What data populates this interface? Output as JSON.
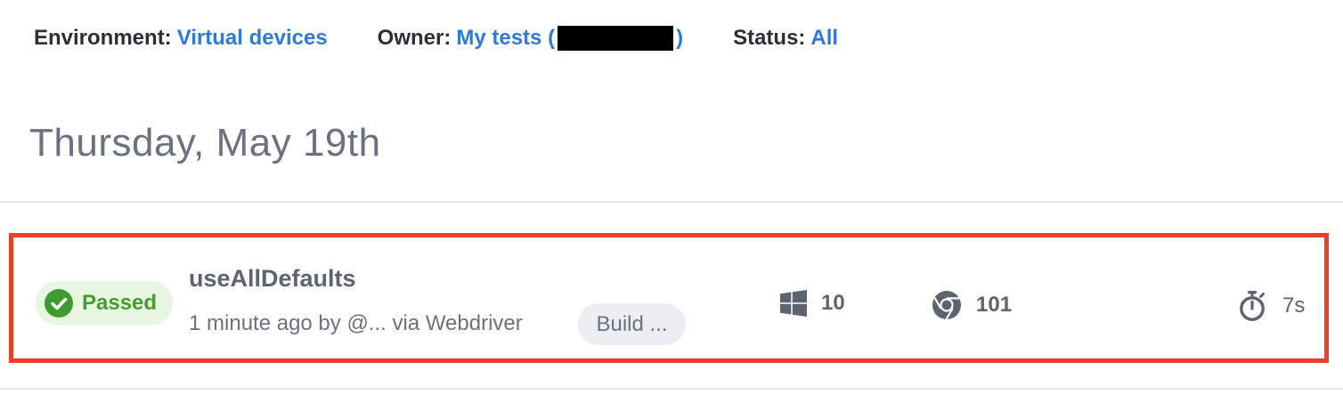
{
  "filters": {
    "environment": {
      "label": "Environment:",
      "value": "Virtual devices"
    },
    "owner": {
      "label": "Owner:",
      "value_prefix": "My tests (",
      "value_suffix": ")"
    },
    "status": {
      "label": "Status:",
      "value": "All"
    }
  },
  "date_heading": "Thursday, May 19th",
  "test": {
    "status": "Passed",
    "name": "useAllDefaults",
    "meta": "1 minute ago by @... via Webdriver",
    "build": "Build ...",
    "os_version": "10",
    "os_icon": "windows-icon",
    "browser_version": "101",
    "browser_icon": "chrome-icon",
    "duration": "7s",
    "duration_icon": "stopwatch-icon"
  },
  "colors": {
    "link": "#2f7ad8",
    "passed_text": "#4a9b2e",
    "passed_bg": "#e7f6e1",
    "highlight_border": "#e8412b"
  }
}
